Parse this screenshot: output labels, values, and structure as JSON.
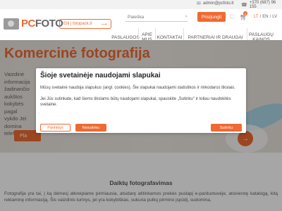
{
  "topbar": {
    "email": "admin@pcfoto.lt",
    "phone": "+370 (687) 96 155"
  },
  "header": {
    "logo_pc": "PC",
    "logo_foto": "FOTO",
    "fotopack_label": "Eiti į fotopack.lt",
    "search_placeholder": "Paieška",
    "login_label": "Prisijungti",
    "cart_count": "0",
    "languages": [
      "LT",
      "EN",
      "LV"
    ],
    "active_language": "LT"
  },
  "nav": [
    {
      "label": "PASLAUGOS"
    },
    {
      "label": "APIE MUS"
    },
    {
      "label": "KONTAKTAI"
    },
    {
      "label": "PARTNERIAI IR DRAUGAI"
    },
    {
      "label": "PASLAUGŲ KAINOS"
    }
  ],
  "hero": {
    "title": "Komercinė fotografija",
    "description": "Vaizdinė informacija žadinančio aukštos kokybės pagal vykdo Jei domina telefonu a",
    "cta_label": "Pla",
    "next_arrow": "→"
  },
  "cookie": {
    "title": "Šioje svetainėje naudojami slapukai",
    "p1": "Mūsų svetainė naudoja slapukus (angl. cookies). Šie slapukai naudojami statistikos ir rinkodaros tikslais.",
    "p2": "Jei Jūs sutinkate, kad šiems tikslams būtų naudojami slapukai, spauskite „Sutinku\" ir toliau naudokitės svetaine.",
    "settings_label": "Parinktys",
    "decline_label": "Nesutinku",
    "agree_label": "Sutinku"
  },
  "content": {
    "section_title": "Daiktų fotografavimas",
    "text": "Fotografija yra tai, į ką dėmesį atkreipiame pirmiausia, atsidarę atitinkamos prekės puslapį e-parduotuvėje, atsiverstę katalogą, kitą reklaminę informaciją. Šis vaizdinis turinys, jei yra kokybiškas, sukuria pulkų pirmino įspūdį, sudomina,"
  },
  "colors": {
    "accent": "#ef6a33",
    "hero_bg": "#ebe5df"
  }
}
